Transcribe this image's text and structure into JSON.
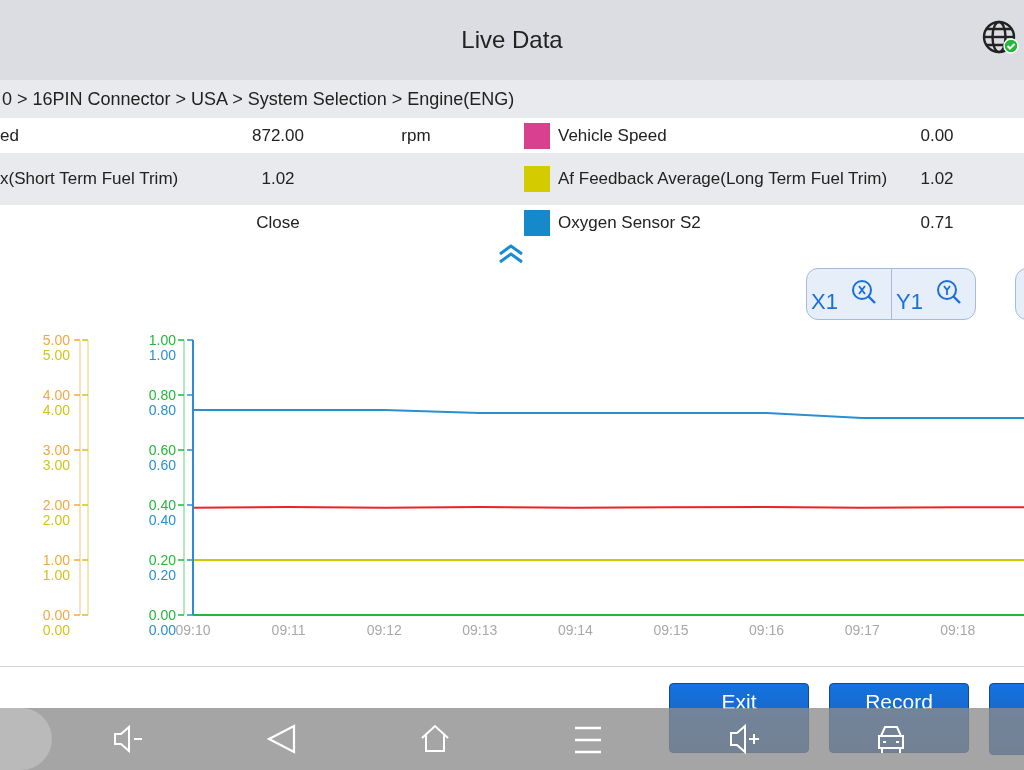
{
  "header": {
    "title": "Live Data"
  },
  "breadcrumb": "0 > 16PIN Connector  > USA  > System Selection  > Engine(ENG)",
  "rows": [
    {
      "left_name": "ed",
      "left_value": "872.00",
      "left_unit": "rpm",
      "color": "#d9418f",
      "right_name": "Vehicle Speed",
      "right_value": "0.00"
    },
    {
      "left_name": "x(Short Term Fuel Trim)",
      "left_value": "1.02",
      "color": "#d4cc00",
      "right_name": "Af Feedback Average(Long Term Fuel Trim)",
      "right_value": "1.02"
    },
    {
      "left_value": "Close",
      "color": "#1589c9",
      "right_name": "Oxygen Sensor S2",
      "right_value": "0.71"
    }
  ],
  "zoom_buttons": [
    {
      "label": "X1",
      "kind": "x"
    },
    {
      "label": "Y1",
      "kind": "y"
    }
  ],
  "chart": {
    "y_axes": [
      {
        "color": "#f5a742",
        "ticks": [
          "5.00",
          "4.00",
          "3.00",
          "2.00",
          "1.00",
          "0.00"
        ]
      },
      {
        "color": "#cfc51a",
        "ticks": [
          "5.00",
          "4.00",
          "3.00",
          "2.00",
          "1.00",
          "0.00"
        ]
      },
      {
        "color": "#22b83a"
      },
      {
        "color": "#2a8fd0",
        "ticks": [
          "1.00",
          "0.80",
          "0.60",
          "0.40",
          "0.20",
          "0.00"
        ]
      }
    ],
    "chart_data": {
      "type": "line",
      "categories": [
        "09:10",
        "09:11",
        "09:12",
        "09:13",
        "09:14",
        "09:15",
        "09:16",
        "09:17",
        "09:18"
      ],
      "ylim": [
        0,
        1
      ],
      "yticks": [
        {
          "value": 0,
          "label": "0.00"
        },
        {
          "value": 0.2,
          "label": "0.20"
        },
        {
          "value": 0.4,
          "label": "0.40"
        },
        {
          "value": 0.6,
          "label": "0.60"
        },
        {
          "value": 0.8,
          "label": "0.80"
        },
        {
          "value": 1,
          "label": "1.00"
        }
      ],
      "series": [
        {
          "color": "#2a8fd0",
          "values": [
            0.745,
            0.745,
            0.745,
            0.735,
            0.735,
            0.735,
            0.735,
            0.716,
            0.716
          ]
        },
        {
          "color": "#e8232a",
          "values": [
            0.39,
            0.393,
            0.39,
            0.393,
            0.39,
            0.392,
            0.393,
            0.39,
            0.392
          ]
        },
        {
          "color": "#d4c800",
          "values": [
            0.2,
            0.2,
            0.2,
            0.2,
            0.2,
            0.2,
            0.2,
            0.2,
            0.2
          ]
        },
        {
          "color": "#22b83a",
          "values": [
            0,
            0,
            0,
            0,
            0,
            0,
            0,
            0,
            0
          ]
        }
      ]
    }
  },
  "buttons": [
    "Exit",
    "Record"
  ]
}
